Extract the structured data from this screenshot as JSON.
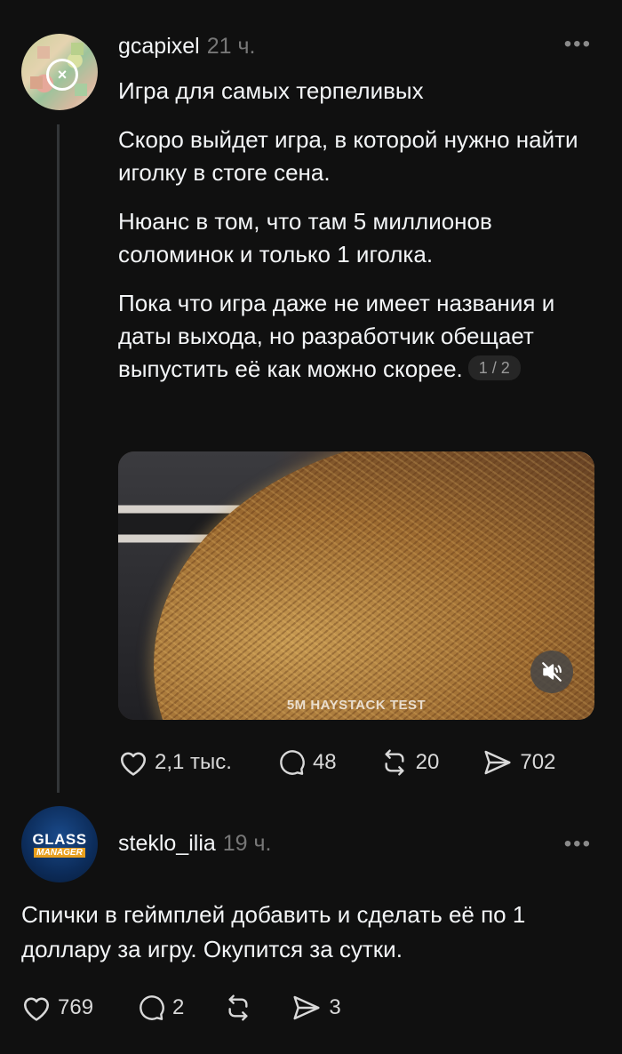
{
  "post": {
    "username": "gcapixel",
    "time": "21 ч.",
    "title": "Игра для самых терпеливых",
    "paragraphs": [
      "Скоро выйдет игра, в которой нужно найти иголку в стоге сена.",
      "Нюанс в том, что там 5 миллионов соломинок и только 1 иголка.",
      "Пока что игра даже не имеет названия и даты выхода, но разработчик обещает выпустить её как можно скорее."
    ],
    "media_counter": "1 / 2",
    "media_caption": "5M HAYSTACK TEST",
    "likes": "2,1 тыс.",
    "comments": "48",
    "reposts": "20",
    "shares": "702"
  },
  "reply": {
    "username": "steklo_ilia",
    "time": "19 ч.",
    "avatar_text_top": "GLASS",
    "avatar_text_bottom": "MANAGER",
    "text": "Спички в геймплей добавить и сделать её по 1 доллару за игру. Окупится за сутки.",
    "likes": "769",
    "comments": "2",
    "reposts": "",
    "shares": "3"
  },
  "icons": {
    "more": "more-dots-icon",
    "like": "heart-icon",
    "comment": "comment-bubble-icon",
    "repost": "repost-arrows-icon",
    "share": "send-paper-plane-icon",
    "mute": "muted-speaker-icon"
  },
  "colors": {
    "background": "#101010",
    "text": "#f3f5f7",
    "muted": "#777777",
    "thread_line": "#333638"
  }
}
